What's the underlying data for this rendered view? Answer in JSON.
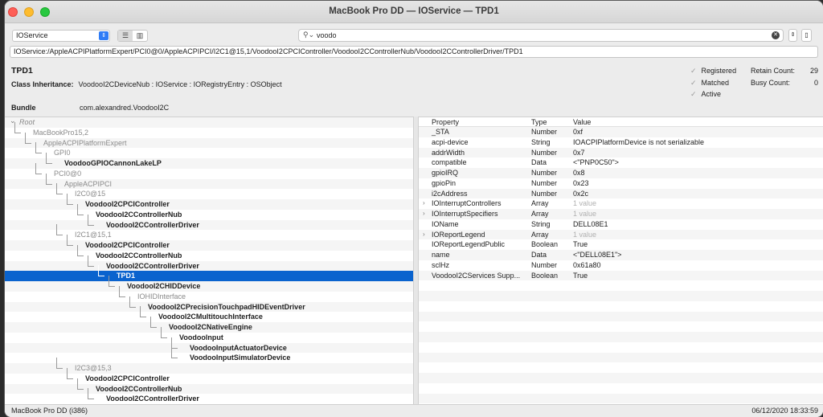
{
  "window": {
    "title": "MacBook Pro DD — IOService — TPD1"
  },
  "toolbar": {
    "plane": "IOService",
    "search_value": "voodo"
  },
  "path": "IOService:/AppleACPIPlatformExpert/PCI0@0/AppleACPIPCI/I2C1@15,1/VoodooI2CPCIController/VoodooI2CControllerNub/VoodooI2CControllerDriver/TPD1",
  "object": {
    "name": "TPD1",
    "class_label": "Class Inheritance:",
    "class_value": "VoodooI2CDeviceNub : IOService : IORegistryEntry : OSObject",
    "bundle_label": "Bundle",
    "bundle_value": "com.alexandred.VoodooI2C"
  },
  "flags": [
    "Registered",
    "Matched",
    "Active"
  ],
  "counts": {
    "retain_label": "Retain Count:",
    "retain": "29",
    "busy_label": "Busy Count:",
    "busy": "0"
  },
  "tree": [
    {
      "t": "Root",
      "d": 0,
      "s": "i"
    },
    {
      "t": "MacBookPro15,2",
      "d": 1,
      "s": "g"
    },
    {
      "t": "AppleACPIPlatformExpert",
      "d": 2,
      "s": "g"
    },
    {
      "t": "GPI0",
      "d": 3,
      "s": "g"
    },
    {
      "t": "VoodooGPIOCannonLakeLP",
      "d": 4,
      "s": "b"
    },
    {
      "t": "PCI0@0",
      "d": 3,
      "s": "g"
    },
    {
      "t": "AppleACPIPCI",
      "d": 4,
      "s": "g"
    },
    {
      "t": "I2C0@15",
      "d": 5,
      "s": "g"
    },
    {
      "t": "VoodooI2CPCIController",
      "d": 6,
      "s": "b"
    },
    {
      "t": "VoodooI2CControllerNub",
      "d": 7,
      "s": "b"
    },
    {
      "t": "VoodooI2CControllerDriver",
      "d": 8,
      "s": "b"
    },
    {
      "t": "I2C1@15,1",
      "d": 5,
      "s": "g"
    },
    {
      "t": "VoodooI2CPCIController",
      "d": 6,
      "s": "b"
    },
    {
      "t": "VoodooI2CControllerNub",
      "d": 7,
      "s": "b"
    },
    {
      "t": "VoodooI2CControllerDriver",
      "d": 8,
      "s": "b"
    },
    {
      "t": "TPD1",
      "d": 9,
      "s": "b",
      "sel": true
    },
    {
      "t": "VoodooI2CHIDDevice",
      "d": 10,
      "s": "b"
    },
    {
      "t": "IOHIDInterface",
      "d": 11,
      "s": "g"
    },
    {
      "t": "VoodooI2CPrecisionTouchpadHIDEventDriver",
      "d": 12,
      "s": "b"
    },
    {
      "t": "VoodooI2CMultitouchInterface",
      "d": 13,
      "s": "b"
    },
    {
      "t": "VoodooI2CNativeEngine",
      "d": 14,
      "s": "b"
    },
    {
      "t": "VoodooInput",
      "d": 15,
      "s": "b"
    },
    {
      "t": "VoodooInputActuatorDevice",
      "d": 16,
      "s": "b"
    },
    {
      "t": "VoodooInputSimulatorDevice",
      "d": 16,
      "s": "b"
    },
    {
      "t": "I2C3@15,3",
      "d": 5,
      "s": "g"
    },
    {
      "t": "VoodooI2CPCIController",
      "d": 6,
      "s": "b"
    },
    {
      "t": "VoodooI2CControllerNub",
      "d": 7,
      "s": "b"
    },
    {
      "t": "VoodooI2CControllerDriver",
      "d": 8,
      "s": "b"
    }
  ],
  "props_header": {
    "property": "Property",
    "type": "Type",
    "value": "Value"
  },
  "props": [
    {
      "p": "_STA",
      "t": "Number",
      "v": "0xf"
    },
    {
      "p": "acpi-device",
      "t": "String",
      "v": "IOACPIPlatformDevice is not serializable"
    },
    {
      "p": "addrWidth",
      "t": "Number",
      "v": "0x7"
    },
    {
      "p": "compatible",
      "t": "Data",
      "v": "<\"PNP0C50\">"
    },
    {
      "p": "gpioIRQ",
      "t": "Number",
      "v": "0x8"
    },
    {
      "p": "gpioPin",
      "t": "Number",
      "v": "0x23"
    },
    {
      "p": "i2cAddress",
      "t": "Number",
      "v": "0x2c"
    },
    {
      "p": "IOInterruptControllers",
      "t": "Array",
      "v": "1 value",
      "exp": true
    },
    {
      "p": "IOInterruptSpecifiers",
      "t": "Array",
      "v": "1 value",
      "exp": true
    },
    {
      "p": "IOName",
      "t": "String",
      "v": "DELL08E1"
    },
    {
      "p": "IOReportLegend",
      "t": "Array",
      "v": "1 value",
      "exp": true
    },
    {
      "p": "IOReportLegendPublic",
      "t": "Boolean",
      "v": "True"
    },
    {
      "p": "name",
      "t": "Data",
      "v": "<\"DELL08E1\">"
    },
    {
      "p": "sclHz",
      "t": "Number",
      "v": "0x61a80"
    },
    {
      "p": "VoodooI2CServices Supp...",
      "t": "Boolean",
      "v": "True"
    }
  ],
  "status": {
    "left": "MacBook Pro DD (i386)",
    "right": "06/12/2020 18:33:59"
  }
}
